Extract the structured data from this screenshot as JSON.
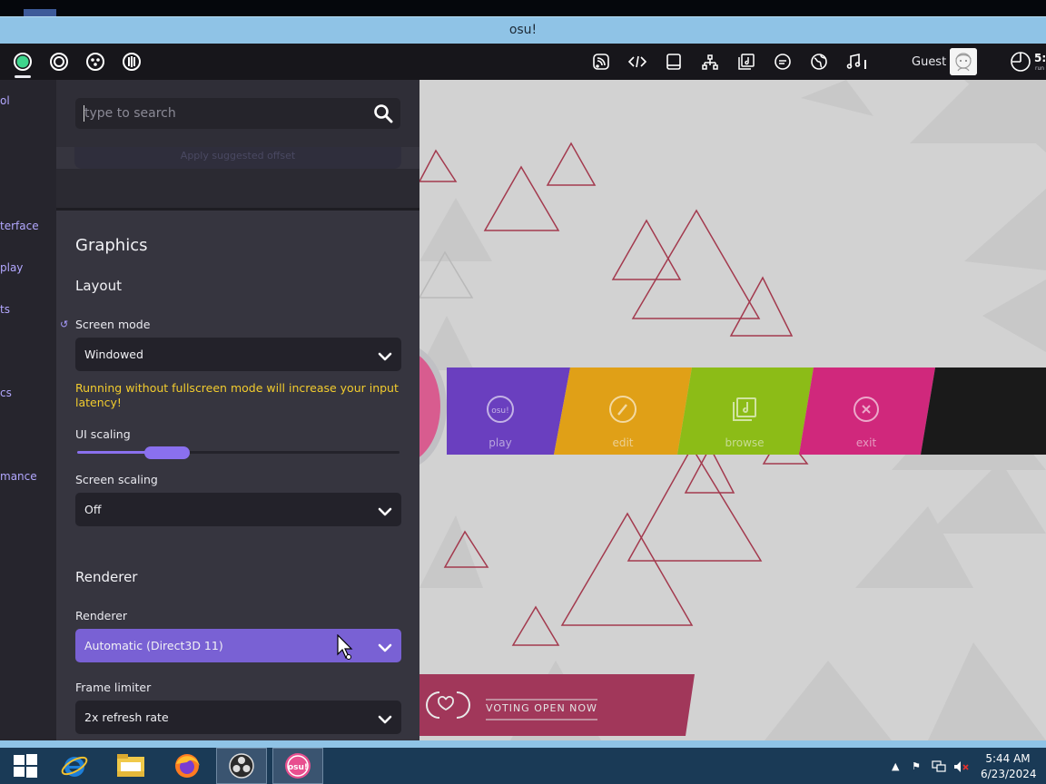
{
  "window": {
    "title": "osu!"
  },
  "toolbar": {
    "user_name": "Guest",
    "clock_time": "5:",
    "clock_sub": "run"
  },
  "nav": {
    "items": [
      {
        "label": "ol"
      },
      {
        "label": "terface"
      },
      {
        "label": "play"
      },
      {
        "label": "ts"
      },
      {
        "label": "cs"
      },
      {
        "label": "mance"
      }
    ]
  },
  "search": {
    "placeholder": "type to search",
    "ghost_button": "Apply suggested offset"
  },
  "settings": {
    "section_title": "Graphics",
    "layout_title": "Layout",
    "screen_mode": {
      "label": "Screen mode",
      "value": "Windowed"
    },
    "warning": "Running without fullscreen mode will increase your input latency!",
    "ui_scaling": {
      "label": "UI scaling",
      "fraction": 0.25
    },
    "screen_scaling": {
      "label": "Screen scaling",
      "value": "Off"
    },
    "renderer_title": "Renderer",
    "renderer": {
      "label": "Renderer",
      "value": "Automatic (Direct3D 11)"
    },
    "frame_limiter": {
      "label": "Frame limiter",
      "value": "2x refresh rate"
    }
  },
  "main_menu": {
    "buttons": [
      {
        "label": "play",
        "color": "#6a3fbf"
      },
      {
        "label": "edit",
        "color": "#e0a017"
      },
      {
        "label": "browse",
        "color": "#8cbc17"
      },
      {
        "label": "exit",
        "color": "#d0287c"
      }
    ],
    "news_text": "VOTING OPEN NOW",
    "logo_text": "osu!"
  },
  "taskbar": {
    "time": "5:44 AM",
    "date": "6/23/2024",
    "osu_label": "osu!"
  },
  "colors": {
    "accent": "#8a70ef",
    "warning": "#f2cc2e",
    "panel": "#36353f",
    "titlebar": "#8fc3e6"
  }
}
